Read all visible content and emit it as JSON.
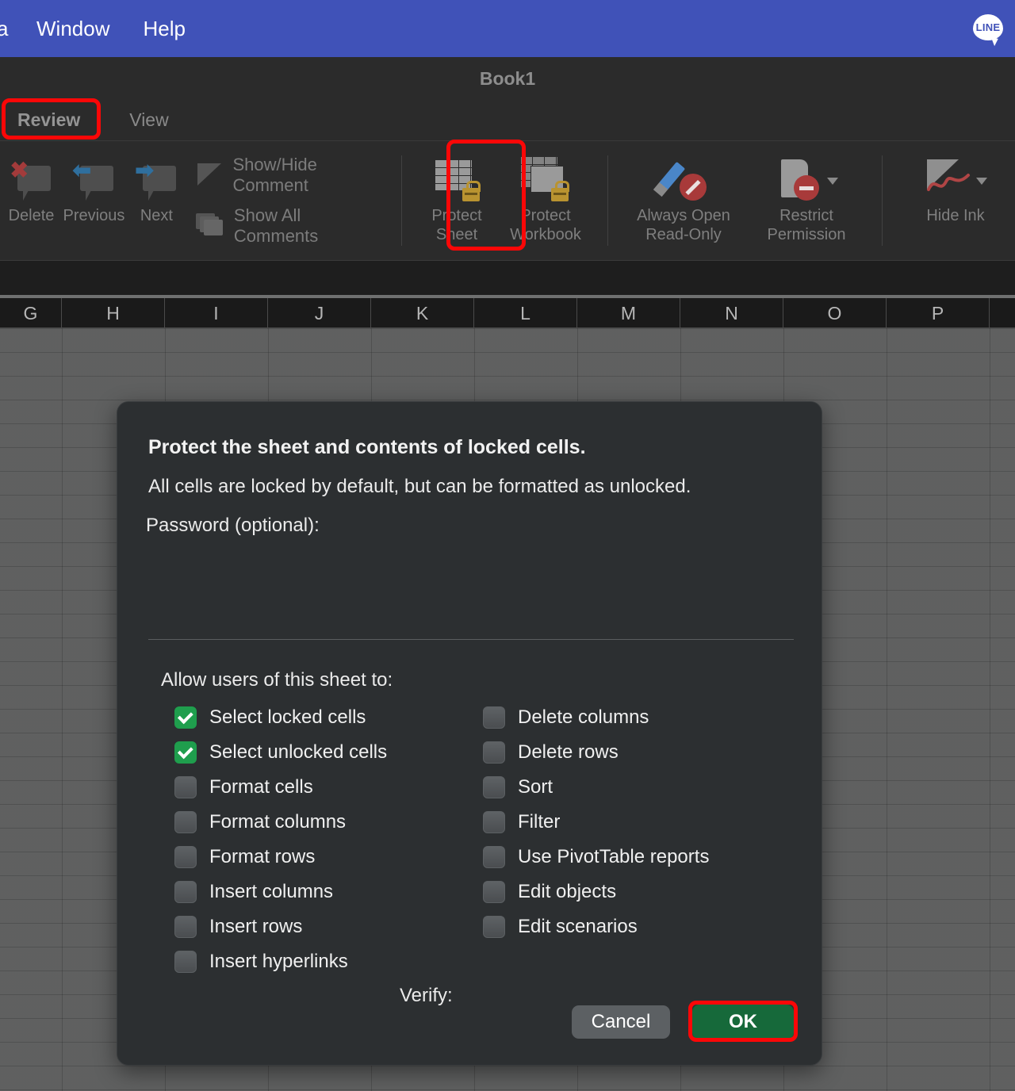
{
  "menubar": {
    "items": [
      {
        "label": "a",
        "name": "menu-item-data"
      },
      {
        "label": "Window",
        "name": "menu-item-window"
      },
      {
        "label": "Help",
        "name": "menu-item-help"
      }
    ],
    "status_icon": {
      "label": "LINE",
      "name": "line-status-icon"
    },
    "accent_color": "#4052b8"
  },
  "window": {
    "title": "Book1",
    "tabs": [
      {
        "label": "Review",
        "active": true
      },
      {
        "label": "View",
        "active": false
      }
    ]
  },
  "ribbon": {
    "groups": [
      {
        "name": "comments-group",
        "buttons": [
          {
            "label": "Delete",
            "icon": "comment-delete-icon"
          },
          {
            "label": "Previous",
            "icon": "comment-previous-icon"
          },
          {
            "label": "Next",
            "icon": "comment-next-icon"
          }
        ],
        "rows": [
          {
            "label": "Show/Hide Comment",
            "icon": "show-hide-comment-icon"
          },
          {
            "label": "Show All Comments",
            "icon": "show-all-comments-icon"
          }
        ]
      },
      {
        "name": "protection-group",
        "buttons": [
          {
            "label_line1": "Protect",
            "label_line2": "Sheet",
            "icon": "protect-sheet-icon"
          },
          {
            "label_line1": "Protect",
            "label_line2": "Workbook",
            "icon": "protect-workbook-icon"
          }
        ]
      },
      {
        "name": "permissions-group",
        "buttons": [
          {
            "label_line1": "Always Open",
            "label_line2": "Read-Only",
            "icon": "always-open-read-only-icon"
          },
          {
            "label_line1": "Restrict",
            "label_line2": "Permission",
            "icon": "restrict-permission-icon"
          }
        ]
      },
      {
        "name": "ink-group",
        "buttons": [
          {
            "label_line1": "Hide Ink",
            "label_line2": "",
            "icon": "hide-ink-icon"
          }
        ]
      }
    ]
  },
  "sheet": {
    "column_headers": [
      "G",
      "H",
      "I",
      "J",
      "K",
      "L",
      "M",
      "N",
      "O",
      "P"
    ]
  },
  "dialog": {
    "title": "Protect the sheet and contents of locked cells.",
    "subtitle": "All cells are locked by default, but can be formatted as unlocked.",
    "password_label": "Password (optional):",
    "password_value": "",
    "verify_label": "Verify:",
    "verify_value": "",
    "allow_label": "Allow users of this sheet to:",
    "permissions_left": [
      {
        "label": "Select locked cells",
        "checked": true
      },
      {
        "label": "Select unlocked cells",
        "checked": true
      },
      {
        "label": "Format cells",
        "checked": false
      },
      {
        "label": "Format columns",
        "checked": false
      },
      {
        "label": "Format rows",
        "checked": false
      },
      {
        "label": "Insert columns",
        "checked": false
      },
      {
        "label": "Insert rows",
        "checked": false
      },
      {
        "label": "Insert hyperlinks",
        "checked": false
      }
    ],
    "permissions_right": [
      {
        "label": "Delete columns",
        "checked": false
      },
      {
        "label": "Delete rows",
        "checked": false
      },
      {
        "label": "Sort",
        "checked": false
      },
      {
        "label": "Filter",
        "checked": false
      },
      {
        "label": "Use PivotTable reports",
        "checked": false
      },
      {
        "label": "Edit objects",
        "checked": false
      },
      {
        "label": "Edit scenarios",
        "checked": false
      }
    ],
    "cancel_label": "Cancel",
    "ok_label": "OK"
  },
  "annotations": {
    "highlight_color": "#fb0707",
    "focus_color": "#2f8a4e",
    "boxes": [
      "review-tab",
      "protect-sheet-button",
      "ok-button"
    ]
  }
}
